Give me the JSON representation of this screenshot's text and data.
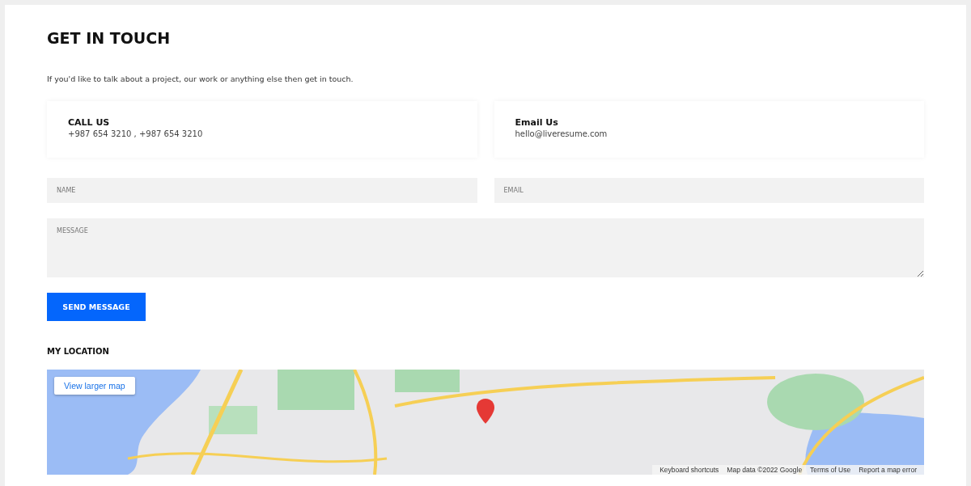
{
  "heading": "GET IN TOUCH",
  "intro": "If you'd like to talk about a project, our work or anything else then get in touch.",
  "contact_cards": [
    {
      "title": "CALL US",
      "value": "+987 654 3210 , +987 654 3210"
    },
    {
      "title": "Email Us",
      "value": "hello@liveresume.com"
    }
  ],
  "form": {
    "fields": [
      {
        "kind": "input",
        "placeholder": "NAME"
      },
      {
        "kind": "input",
        "placeholder": "EMAIL"
      },
      {
        "kind": "textarea",
        "placeholder": "MESSAGE"
      }
    ],
    "submit": "SEND MESSAGE"
  },
  "location": {
    "title": "MY LOCATION",
    "map": {
      "kind": "picture",
      "larger_map_link": "View larger map",
      "footer": [
        "Keyboard shortcuts",
        "Map data ©2022 Google",
        "Terms of Use",
        "Report a map error"
      ]
    }
  }
}
